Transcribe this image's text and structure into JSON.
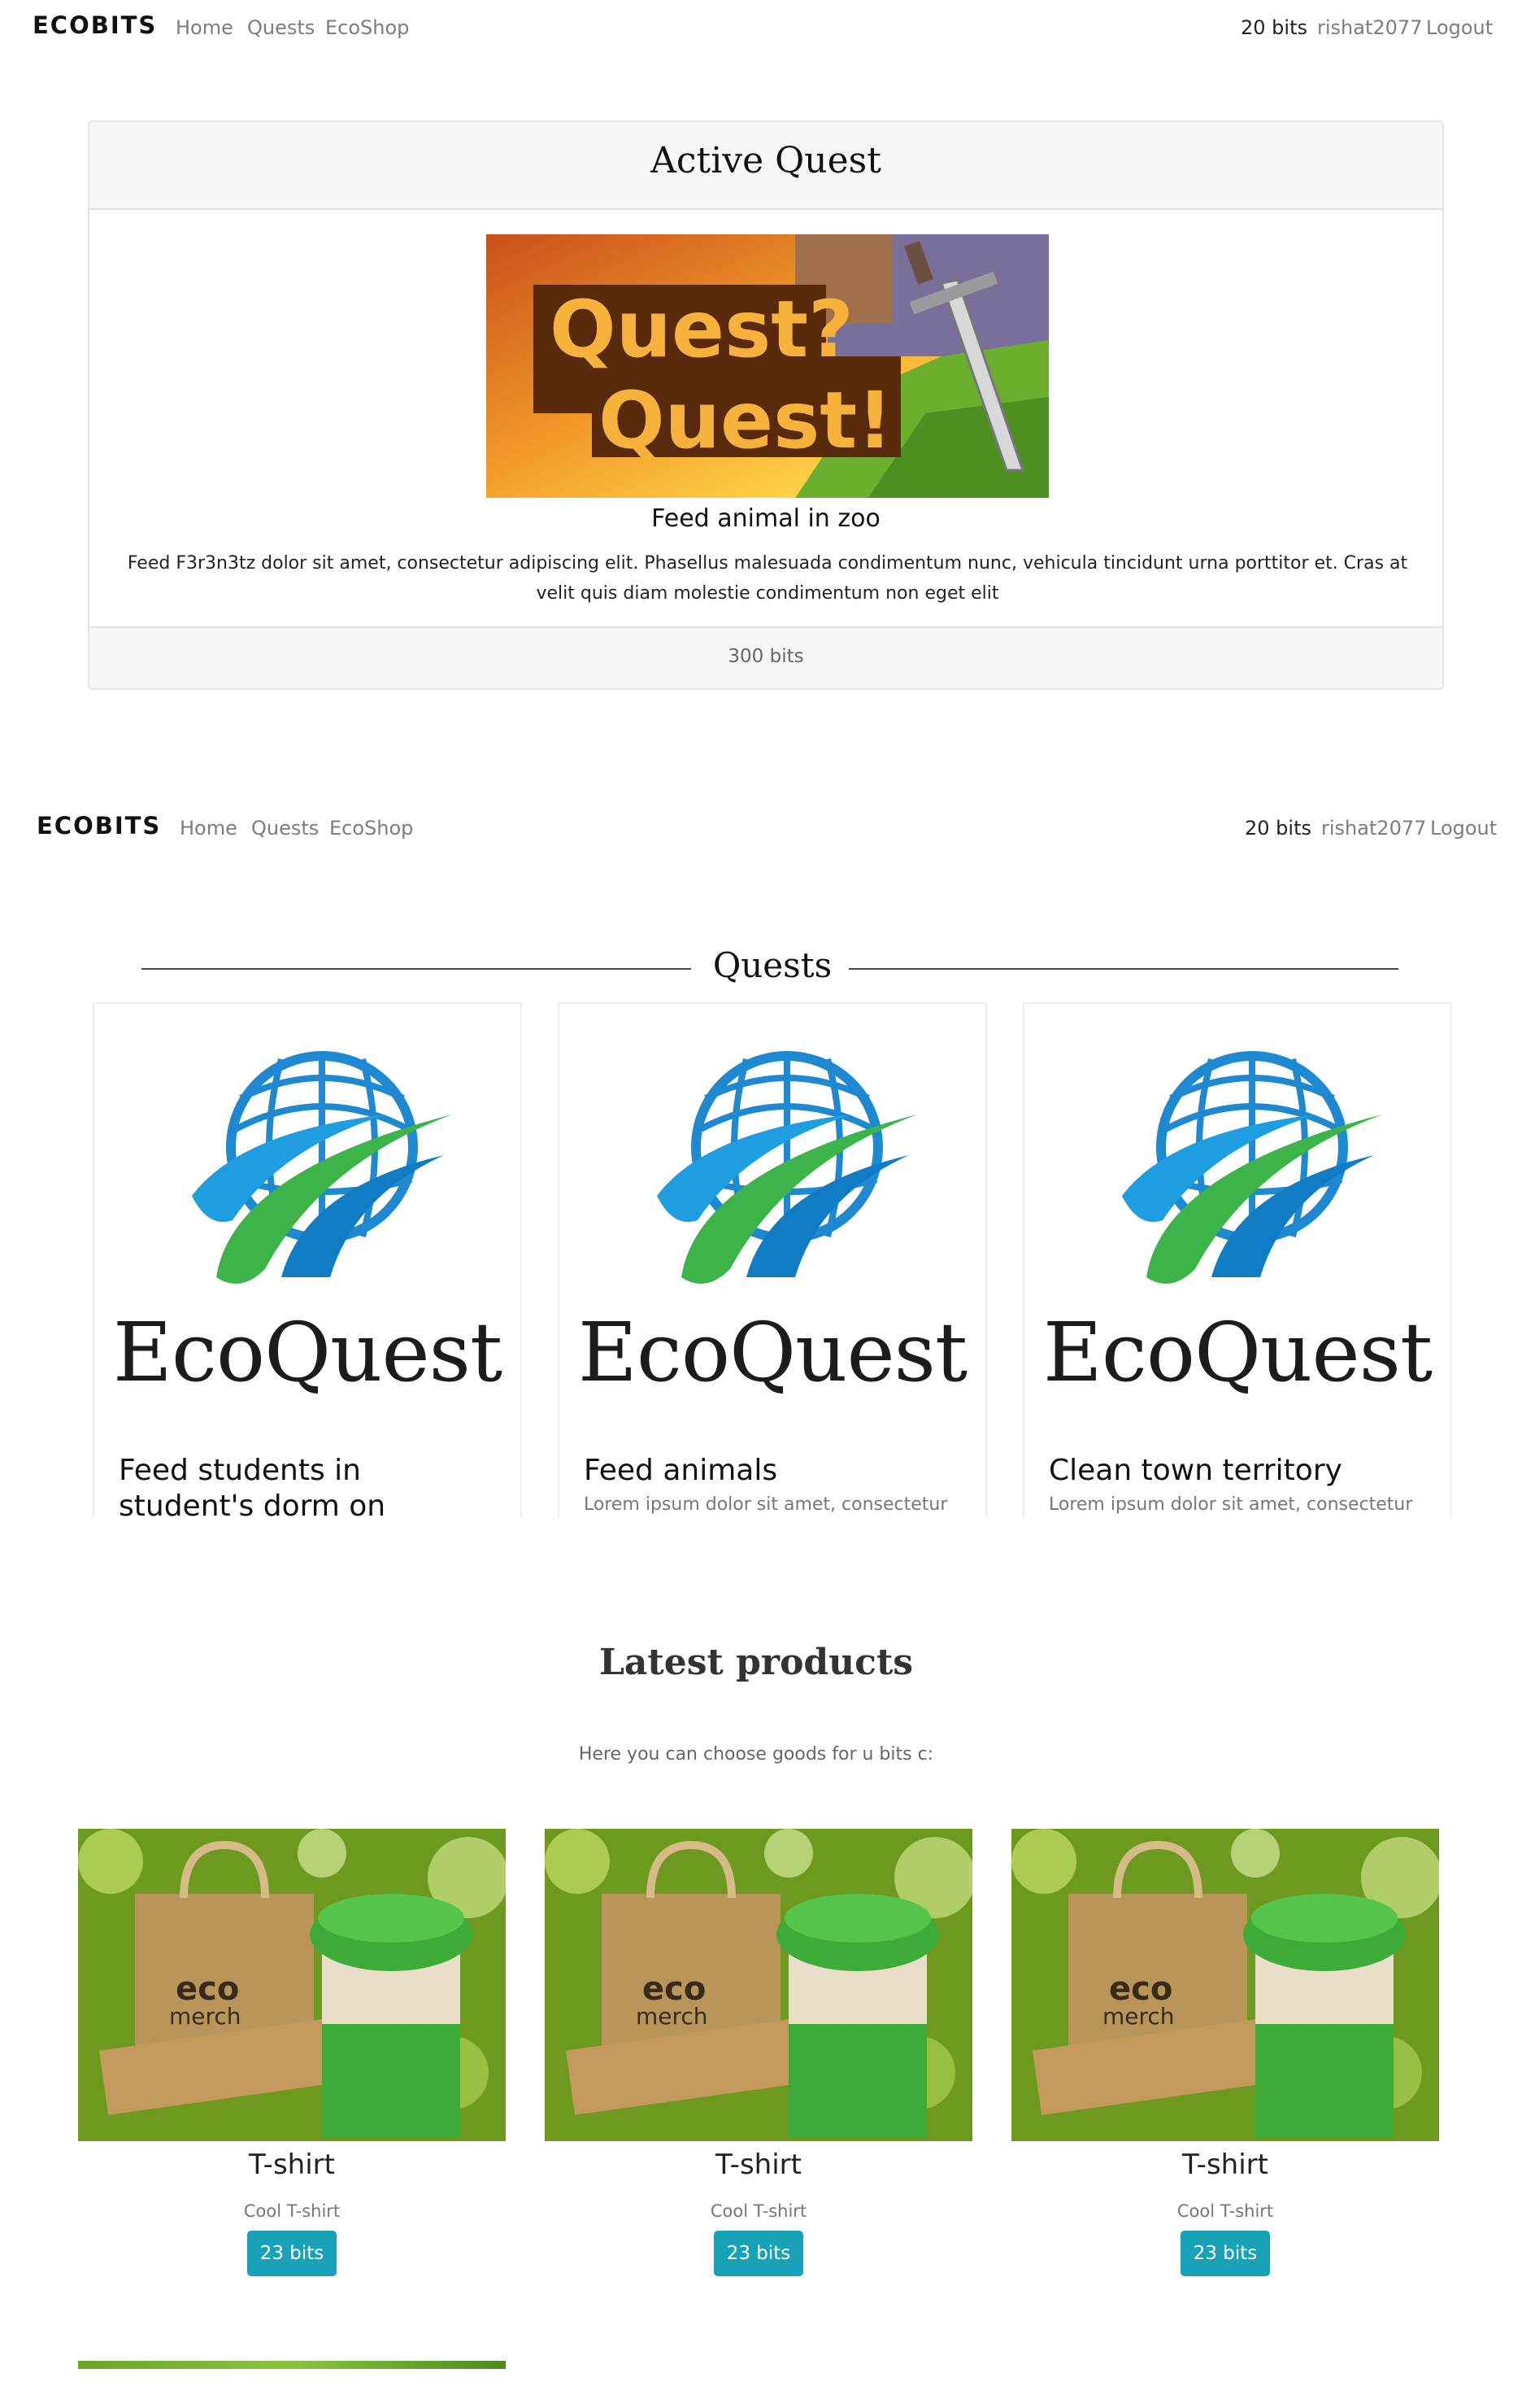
{
  "navbar": {
    "brand": "ECOBITS",
    "links": [
      "Home",
      "Quests",
      "EcoShop"
    ],
    "bits": "20 bits",
    "user": "rishat2077",
    "logout": "Logout"
  },
  "active_quest": {
    "heading": "Active Quest",
    "image_text_1": "Quest?",
    "image_text_2": "Quest!",
    "name": "Feed animal in zoo",
    "description": "Feed F3r3n3tz dolor sit amet, consectetur adipiscing elit. Phasellus malesuada condimentum nunc, vehicula tincidunt urna porttitor et. Cras at velit quis diam molestie condimentum non eget elit",
    "reward": "300 bits"
  },
  "quests": {
    "heading": "Quests",
    "logo_text": "EcoQuest",
    "items": [
      {
        "title": "Feed students in student's dorm on Pushkina street",
        "text": ""
      },
      {
        "title": "Feed animals",
        "text": "Lorem ipsum dolor sit amet, consectetur"
      },
      {
        "title": "Clean town territory",
        "text": "Lorem ipsum dolor sit amet, consectetur"
      }
    ]
  },
  "products": {
    "heading": "Latest products",
    "subheading": "Here you can choose goods for u bits c:",
    "image_text_eco": "eco",
    "image_text_merch": "merch",
    "items": [
      {
        "title": "T-shirt",
        "desc": "Cool T-shirt",
        "price": "23 bits"
      },
      {
        "title": "T-shirt",
        "desc": "Cool T-shirt",
        "price": "23 bits"
      },
      {
        "title": "T-shirt",
        "desc": "Cool T-shirt",
        "price": "23 bits"
      }
    ]
  },
  "colors": {
    "accent": "#17a2b8",
    "card_header_bg": "#f7f7f7",
    "logo_blue": "#1e88d0",
    "logo_green": "#3cb44a"
  }
}
